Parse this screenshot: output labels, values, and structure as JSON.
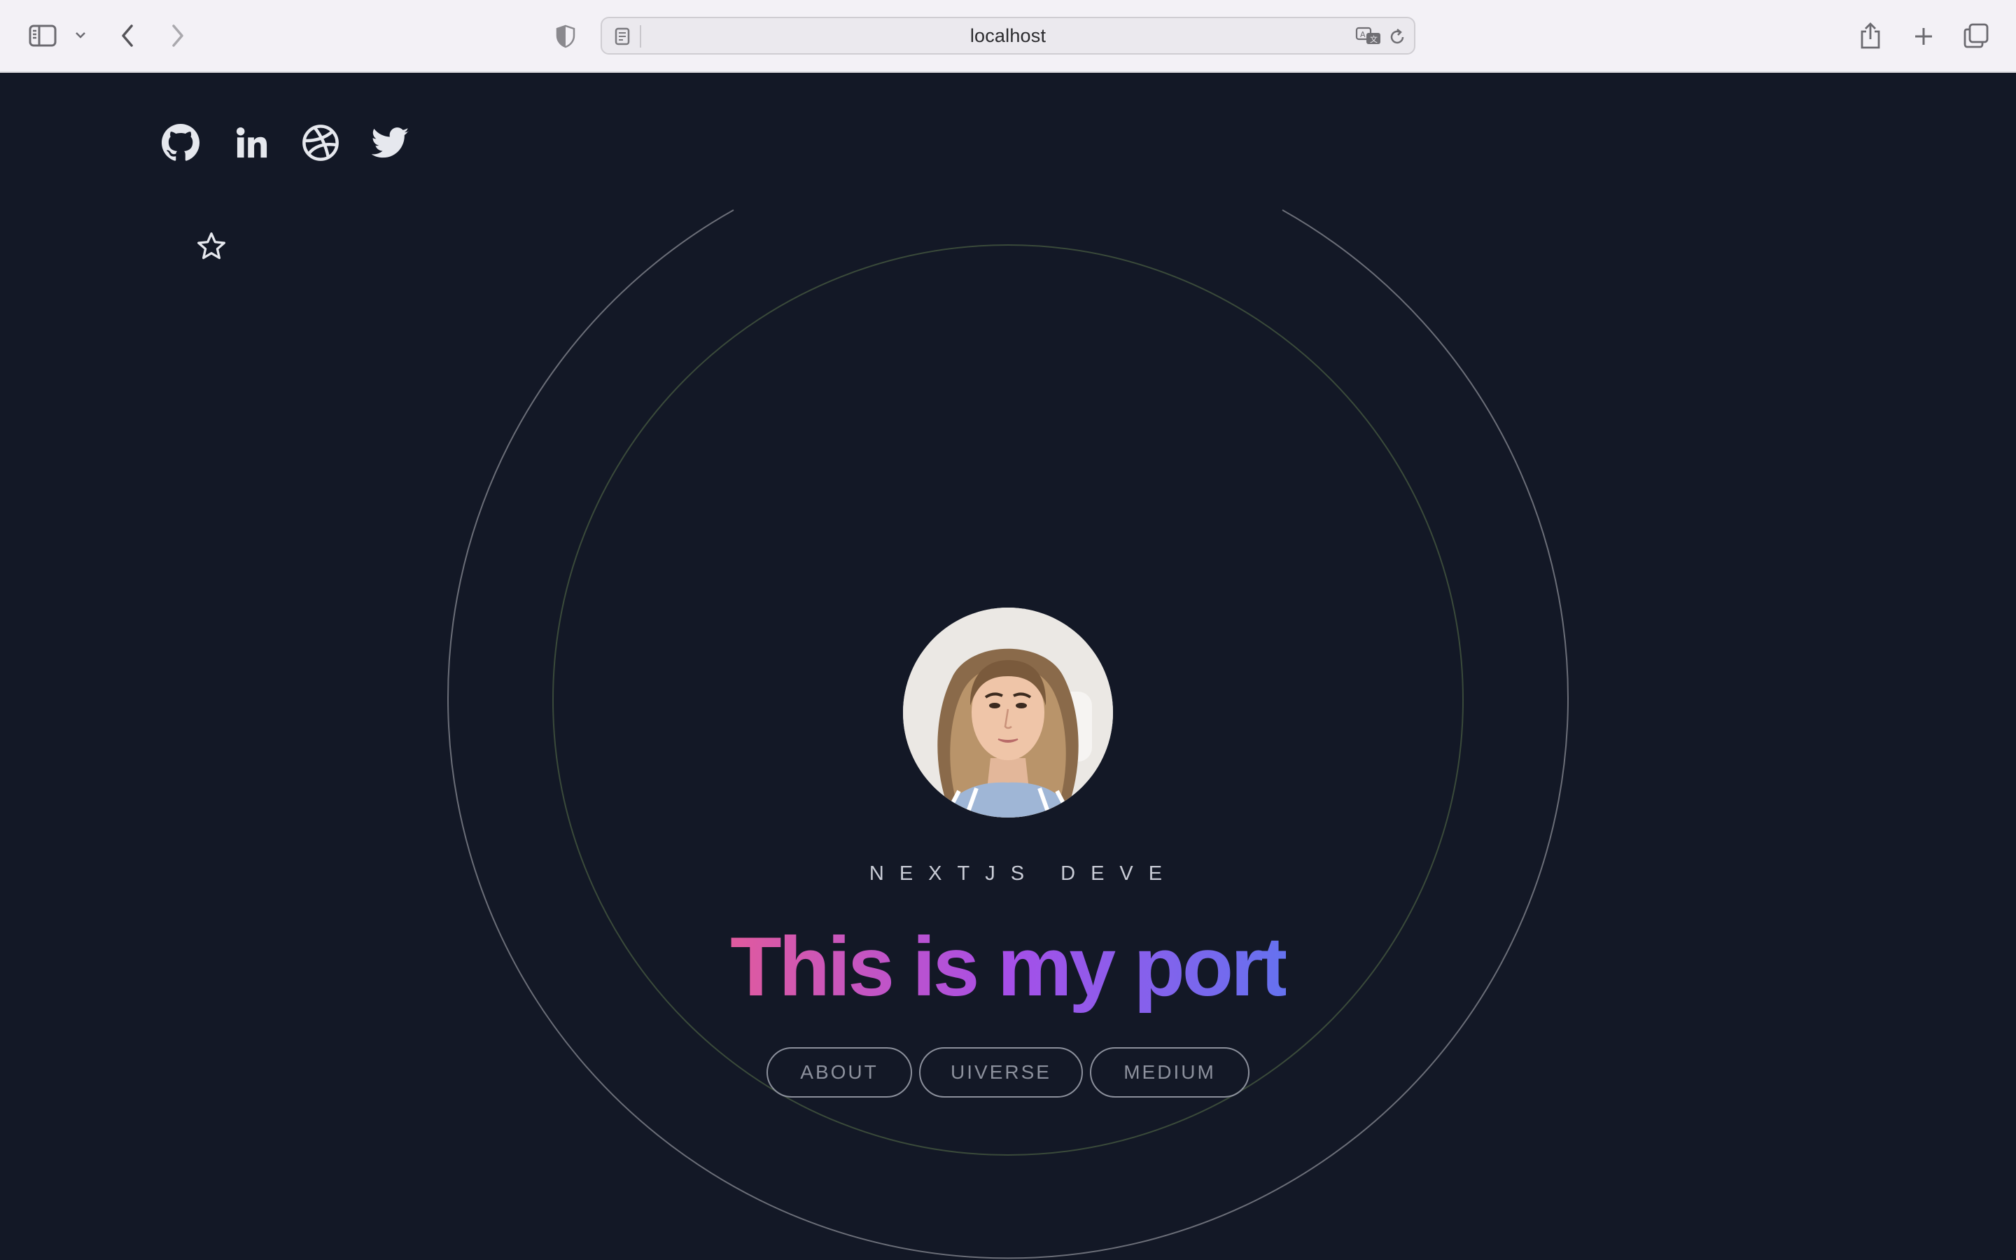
{
  "browser": {
    "url": "localhost",
    "icons": {
      "sidebar": "sidebar-toggle-icon",
      "sidebar_menu": "chevron-down-icon",
      "back": "chevron-left-icon",
      "forward": "chevron-right-icon",
      "privacy": "shield-icon",
      "reader": "reader-mode-icon",
      "translate": "translate-icon",
      "reload": "reload-icon",
      "share": "share-icon",
      "new_tab": "plus-icon",
      "tabs": "tab-overview-icon"
    }
  },
  "social_links": [
    {
      "name": "github",
      "icon": "github-icon"
    },
    {
      "name": "linkedin",
      "icon": "linkedin-icon"
    },
    {
      "name": "dribbble",
      "icon": "dribbble-icon"
    },
    {
      "name": "twitter",
      "icon": "twitter-icon"
    }
  ],
  "hero": {
    "subtitle": "NEXTJS DEVE",
    "headline": "This is my port",
    "headline_gradient": [
      "#e05a9e",
      "#a64fe8",
      "#6572ef"
    ],
    "buttons": [
      {
        "label": "ABOUT"
      },
      {
        "label": "UIVERSE"
      },
      {
        "label": "MEDIUM"
      }
    ]
  },
  "colors": {
    "background": "#131826",
    "chrome": "#f3f1f6",
    "outer_ring": "#6b6e78",
    "inner_ring": "#3c4a3c",
    "button_border": "#8c909c"
  }
}
